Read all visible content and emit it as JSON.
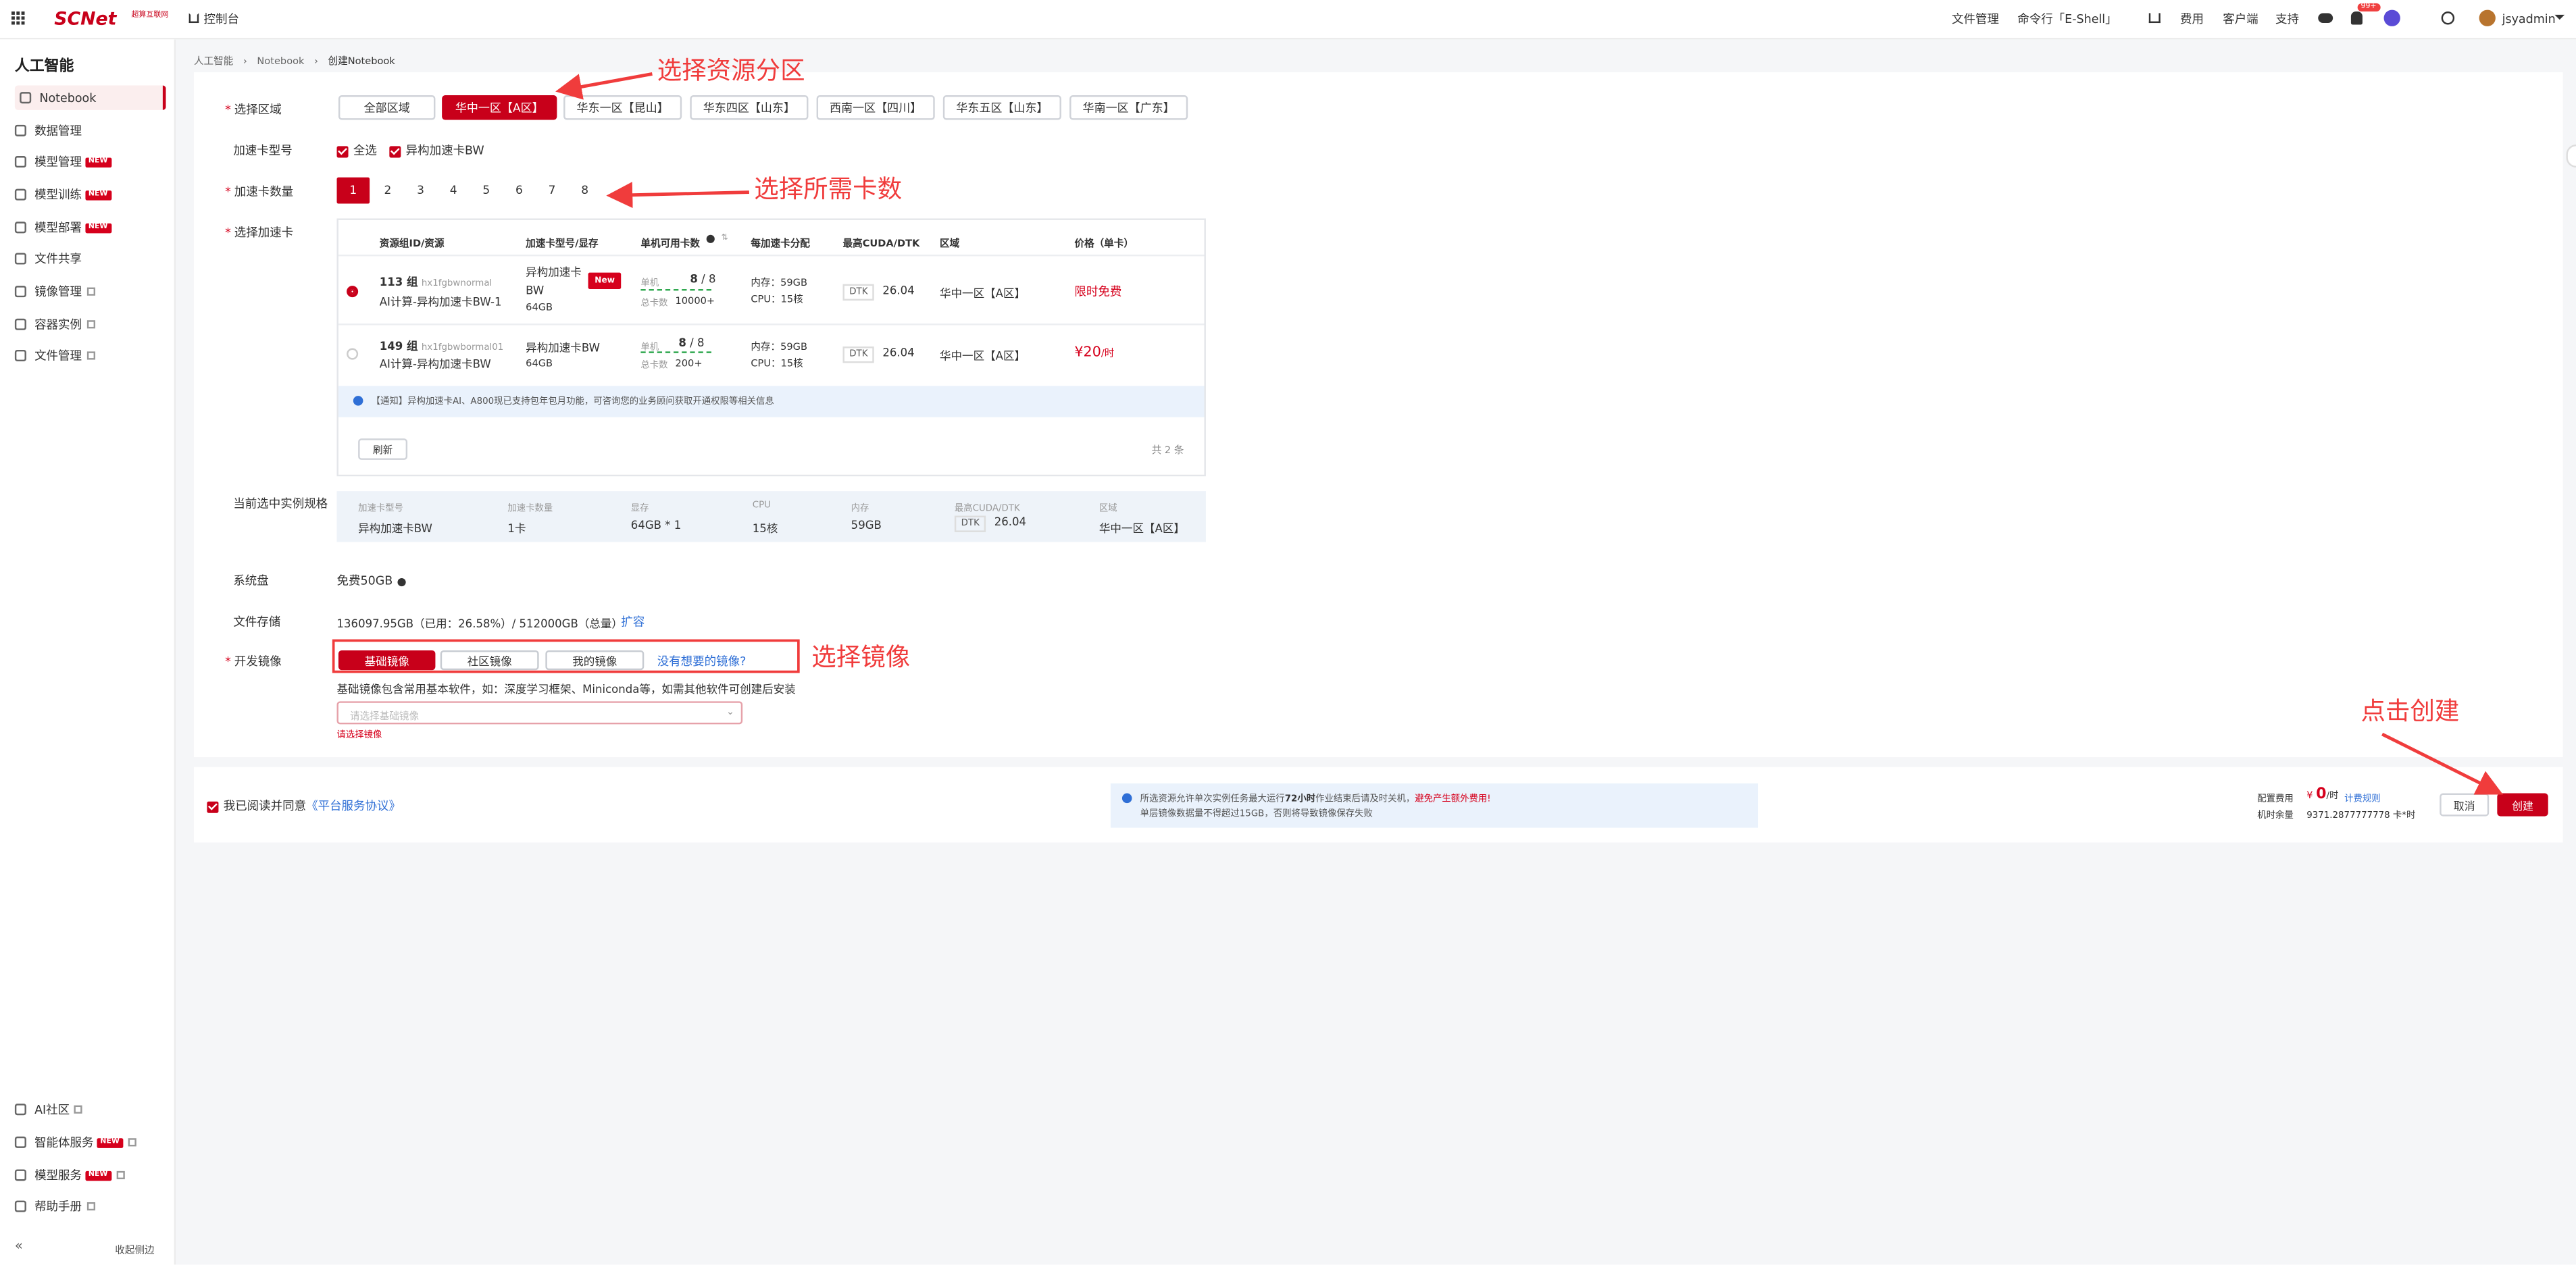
{
  "header": {
    "brand": "SCNet",
    "brand_sub": "超算互联网",
    "console": "控制台",
    "nav": [
      "文件管理",
      "命令行「E-Shell」",
      "费用",
      "客户端",
      "支持"
    ],
    "notify_count": "99+",
    "user": "jsyadmin"
  },
  "sidebar": {
    "title": "人工智能",
    "items": [
      {
        "label": "Notebook",
        "icon": "notebook-icon"
      },
      {
        "label": "数据管理",
        "icon": "database-icon"
      },
      {
        "label": "模型管理",
        "icon": "model-icon",
        "badge": "NEW"
      },
      {
        "label": "模型训练",
        "icon": "train-icon",
        "badge": "NEW"
      },
      {
        "label": "模型部署",
        "icon": "deploy-icon",
        "badge": "NEW"
      },
      {
        "label": "文件共享",
        "icon": "file-share-icon"
      },
      {
        "label": "镜像管理",
        "icon": "image-icon"
      },
      {
        "label": "容器实例",
        "icon": "container-icon"
      },
      {
        "label": "文件管理",
        "icon": "folder-icon"
      }
    ],
    "bottom_items": [
      {
        "label": "AI社区",
        "icon": "community-icon"
      },
      {
        "label": "智能体服务",
        "icon": "agent-icon",
        "badge": "NEW"
      },
      {
        "label": "模型服务",
        "icon": "model-service-icon",
        "badge": "NEW"
      },
      {
        "label": "帮助手册",
        "icon": "help-icon"
      }
    ],
    "collapse": "收起侧边"
  },
  "breadcrumb": [
    "人工智能",
    "Notebook",
    "创建Notebook"
  ],
  "form": {
    "region_label": "选择区域",
    "regions": [
      "全部区域",
      "华中一区【A区】",
      "华东一区【昆山】",
      "华东四区【山东】",
      "西南一区【四川】",
      "华东五区【山东】",
      "华南一区【广东】"
    ],
    "selected_region": "华中一区【A区】",
    "card_type_label": "加速卡型号",
    "card_type_options": [
      "全选",
      "异构加速卡BW"
    ],
    "card_count_label": "加速卡数量",
    "card_counts": [
      "1",
      "2",
      "3",
      "4",
      "5",
      "6",
      "7",
      "8"
    ],
    "selected_count": "1",
    "select_card_label": "选择加速卡",
    "table_headers": [
      "资源组ID/资源",
      "加速卡型号/显存",
      "单机可用卡数",
      "每加速卡分配",
      "最高CUDA/DTK",
      "区域",
      "价格（单卡）"
    ],
    "rows": [
      {
        "group": "113 组",
        "group_id": "hx1fgbwnormal",
        "resource": "AI计算-异构加速卡BW-1",
        "card_model": "异构加速卡BW",
        "memory": "64GB",
        "tag": "New",
        "single_label": "单机",
        "avail": "8",
        "total_single": "8",
        "total_label": "总卡数",
        "total": "10000+",
        "mem": "内存：59GB",
        "cpu": "CPU：15核",
        "dtk": "DTK",
        "dtk_ver": "26.04",
        "region": "华中一区【A区】",
        "price": "限时免费",
        "selected": true
      },
      {
        "group": "149 组",
        "group_id": "hx1fgbwbormal01",
        "resource": "AI计算-异构加速卡BW",
        "card_model": "异构加速卡BW",
        "memory": "64GB",
        "tag": "",
        "single_label": "单机",
        "avail": "8",
        "total_single": "8",
        "total_label": "总卡数",
        "total": "200+",
        "mem": "内存：59GB",
        "cpu": "CPU：15核",
        "dtk": "DTK",
        "dtk_ver": "26.04",
        "region": "华中一区【A区】",
        "price": "¥20",
        "price_unit": "/时",
        "selected": false
      }
    ],
    "notice": "【通知】异构加速卡AI、A800现已支持包年包月功能，可咨询您的业务顾问获取开通权限等相关信息",
    "refresh": "刷新",
    "total_text": "共 2 条",
    "spec_label": "当前选中实例规格",
    "spec": {
      "card_model_k": "加速卡型号",
      "card_model_v": "异构加速卡BW",
      "count_k": "加速卡数量",
      "count_v": "1卡",
      "vram_k": "显存",
      "vram_v": "64GB * 1",
      "cpu_k": "CPU",
      "cpu_v": "15核",
      "mem_k": "内存",
      "mem_v": "59GB",
      "cuda_k": "最高CUDA/DTK",
      "cuda_tag": "DTK",
      "cuda_v": "26.04",
      "region_k": "区域",
      "region_v": "华中一区【A区】"
    },
    "disk_label": "系统盘",
    "disk_value": "免费50GB",
    "storage_label": "文件存储",
    "storage_value": "136097.95GB（已用：26.58%）/ 512000GB（总量）",
    "storage_expand": "扩容",
    "image_label": "开发镜像",
    "image_tabs": [
      "基础镜像",
      "社区镜像",
      "我的镜像"
    ],
    "image_link": "没有想要的镜像?",
    "image_desc": "基础镜像包含常用基本软件，如：深度学习框架、Miniconda等，如需其他软件可创建后安装",
    "image_placeholder": "请选择基础镜像",
    "image_error": "请选择镜像"
  },
  "footer": {
    "agree_prefix": "我已阅读并同意",
    "agree_link": "《平台服务协议》",
    "info_line1_a": "所选资源允许单次实例任务最大运行",
    "info_line1_b": "72小时",
    "info_line1_c": "作业结束后请及时关机，",
    "info_line1_d": "避免产生额外费用!",
    "info_line2": "单层镜像数据量不得超过15GB，否则将导致镜像保存失败",
    "cost_label": "配置费用",
    "cost_currency": "¥",
    "cost_value": "0",
    "cost_unit": "/时",
    "billing_link": "计费规则",
    "balance_label": "机时余量",
    "balance_value": "9371.2877777778 卡*时",
    "cancel": "取消",
    "create": "创建"
  },
  "annotations": [
    "选择资源分区",
    "选择所需卡数",
    "选择镜像",
    "点击创建"
  ]
}
